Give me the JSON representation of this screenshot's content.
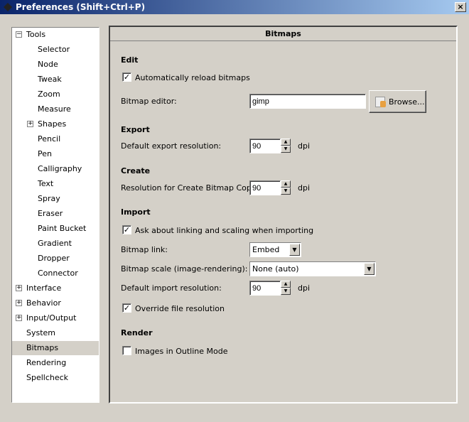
{
  "window": {
    "title": "Preferences (Shift+Ctrl+P)",
    "close": "×"
  },
  "tree": [
    {
      "label": "Tools",
      "level": 0,
      "expander": "−"
    },
    {
      "label": "Selector",
      "level": 1
    },
    {
      "label": "Node",
      "level": 1
    },
    {
      "label": "Tweak",
      "level": 1
    },
    {
      "label": "Zoom",
      "level": 1
    },
    {
      "label": "Measure",
      "level": 1
    },
    {
      "label": "Shapes",
      "level": 1,
      "expander": "+"
    },
    {
      "label": "Pencil",
      "level": 1
    },
    {
      "label": "Pen",
      "level": 1
    },
    {
      "label": "Calligraphy",
      "level": 1
    },
    {
      "label": "Text",
      "level": 1
    },
    {
      "label": "Spray",
      "level": 1
    },
    {
      "label": "Eraser",
      "level": 1
    },
    {
      "label": "Paint Bucket",
      "level": 1
    },
    {
      "label": "Gradient",
      "level": 1
    },
    {
      "label": "Dropper",
      "level": 1
    },
    {
      "label": "Connector",
      "level": 1
    },
    {
      "label": "Interface",
      "level": 0,
      "expander": "+"
    },
    {
      "label": "Behavior",
      "level": 0,
      "expander": "+"
    },
    {
      "label": "Input/Output",
      "level": 0,
      "expander": "+"
    },
    {
      "label": "System",
      "level": 0
    },
    {
      "label": "Bitmaps",
      "level": 0,
      "selected": true
    },
    {
      "label": "Rendering",
      "level": 0
    },
    {
      "label": "Spellcheck",
      "level": 0
    }
  ],
  "panel": {
    "title": "Bitmaps",
    "edit": {
      "heading": "Edit",
      "auto_reload": "Automatically reload bitmaps",
      "auto_reload_checked": true,
      "editor_label": "Bitmap editor:",
      "editor_value": "gimp",
      "browse": "Browse..."
    },
    "export": {
      "heading": "Export",
      "res_label": "Default export resolution:",
      "res_value": "90",
      "unit": "dpi"
    },
    "create": {
      "heading": "Create",
      "res_label": "Resolution for Create Bitmap Copy:",
      "res_value": "90",
      "unit": "dpi"
    },
    "import": {
      "heading": "Import",
      "ask": "Ask about linking and scaling when importing",
      "ask_checked": true,
      "link_label": "Bitmap link:",
      "link_value": "Embed",
      "scale_label": "Bitmap scale (image-rendering):",
      "scale_value": "None (auto)",
      "res_label": "Default import resolution:",
      "res_value": "90",
      "unit": "dpi",
      "override": "Override file resolution",
      "override_checked": true
    },
    "render": {
      "heading": "Render",
      "outline": "Images in Outline Mode",
      "outline_checked": false
    }
  }
}
